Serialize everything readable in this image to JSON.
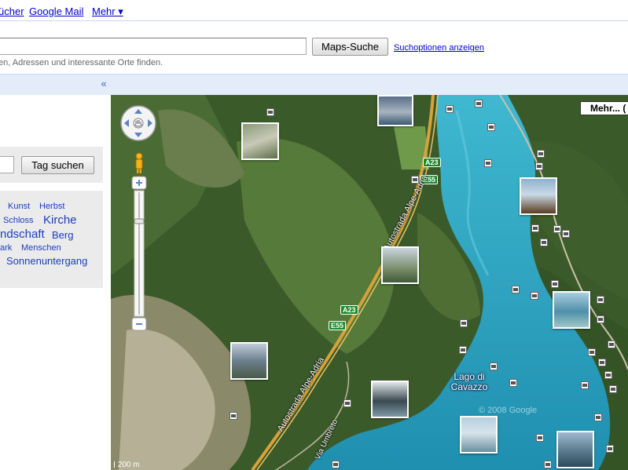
{
  "topnav": {
    "links": [
      "ücher",
      "Google Mail",
      "Mehr ▾"
    ]
  },
  "search": {
    "button_label": "Maps-Suche",
    "options_link": "Suchoptionen anzeigen",
    "hint": "en, Adressen und interessante Orte finden."
  },
  "sidebar": {
    "collapse_icon": "«",
    "tag_button": "Tag suchen",
    "tags": [
      "Kunst",
      "Herbst",
      "Schloss",
      "Kirche",
      "ndschaft",
      "Berg",
      "ark",
      "Menschen",
      "Sonnenuntergang"
    ]
  },
  "map": {
    "more_button": "Mehr... (",
    "lake_label": "Lago di Cavazzo",
    "road_labels": [
      "A23",
      "E55",
      "A23",
      "E55"
    ],
    "motorway_labels": [
      "Autostrada Alpe-Adria",
      "Autostrada Alpe-Adria",
      "Via Umbreto"
    ],
    "watermark": "© 2008 Google",
    "scale": "200 m"
  },
  "colors": {
    "link": "#0000cc",
    "bluebar": "#e5ecf9",
    "lake": "#2aa3c2",
    "forest": "#2f4a22"
  }
}
